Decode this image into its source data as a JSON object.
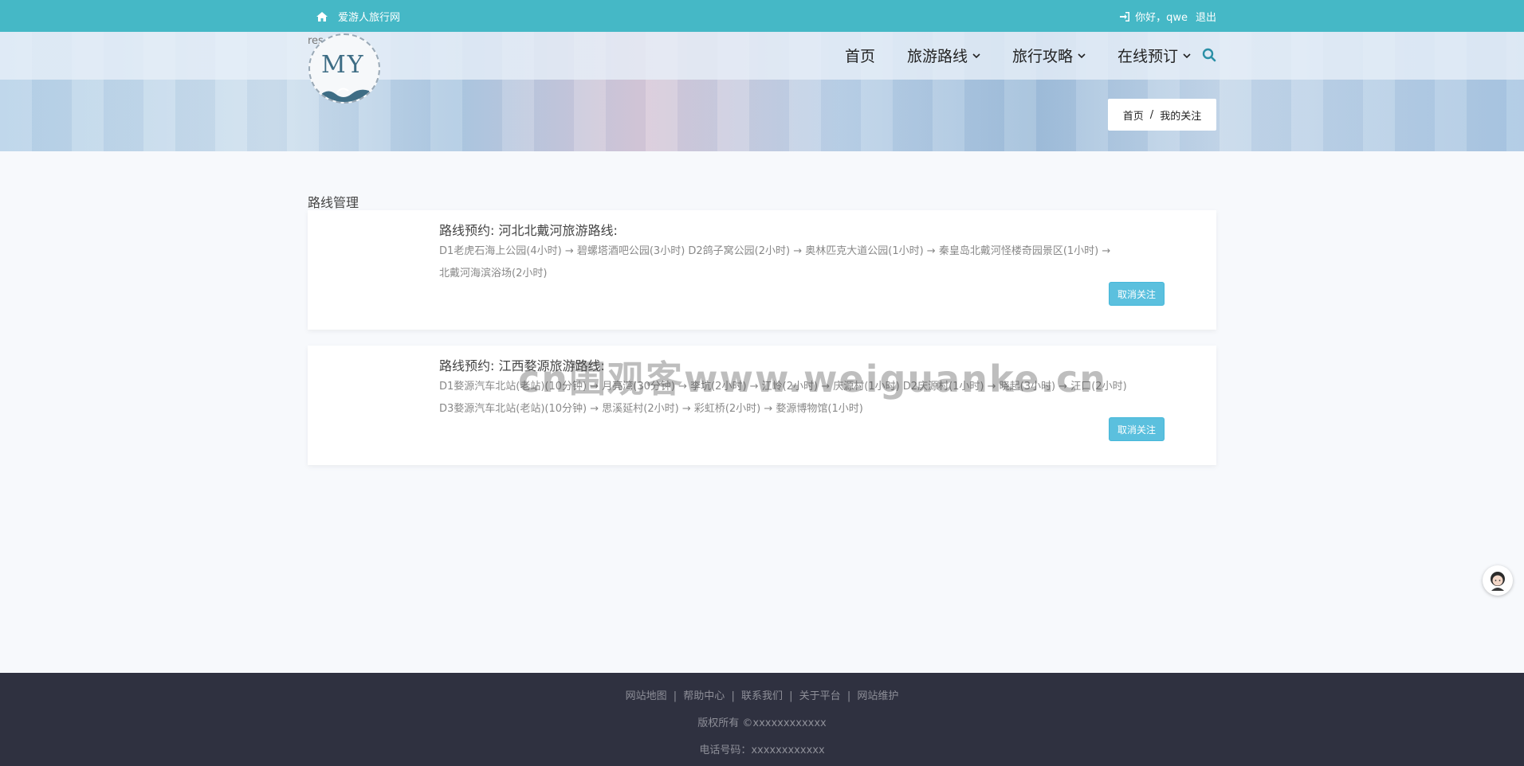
{
  "topbar": {
    "site_name": "爱游人旅行网",
    "greeting": "你好，qwe",
    "logout": "退出",
    "home_icon": "home-icon",
    "login_icon": "sign-in-icon",
    "bg_color": "#45b8c6"
  },
  "header": {
    "res_text": "res",
    "logo_text": "MY",
    "nav": [
      {
        "label": "首页",
        "has_dropdown": false
      },
      {
        "label": "旅游路线",
        "has_dropdown": true
      },
      {
        "label": "旅行攻略",
        "has_dropdown": true
      },
      {
        "label": "在线预订",
        "has_dropdown": true
      }
    ],
    "search_icon": "search-icon"
  },
  "breadcrumb": {
    "home": "首页",
    "sep": "/",
    "current": "我的关注"
  },
  "main": {
    "section_title": "路线管理",
    "cards": [
      {
        "title": "路线预约: 河北北戴河旅游路线:",
        "desc_line1": "D1老虎石海上公园(4小时) → 碧螺塔酒吧公园(3小时) D2鸽子窝公园(2小时) → 奥林匹克大道公园(1小时) → 秦皇岛北戴河怪楼奇园景区(1小时) →",
        "desc_line2": "北戴河海滨浴场(2小时)",
        "button": "取消关注"
      },
      {
        "title": "路线预约: 江西婺源旅游路线:",
        "desc_line1": "D1婺源汽车北站(老站)(10分钟) → 月亮湾(30分钟) → 李坑(2小时) → 江岭(2小时) → 庆源村(1小时) D2庆源村(1小时) → 晓起(3小时) → 汪口(2小时)",
        "desc_line2": "D3婺源汽车北站(老站)(10分钟) → 思溪延村(2小时) → 彩虹桥(2小时) → 婺源博物馆(1小时)",
        "button": "取消关注"
      }
    ]
  },
  "watermark": "cn围观客www.weiguanke.cn",
  "footer": {
    "links": [
      "网站地图",
      "帮助中心",
      "联系我们",
      "关于平台",
      "网站维护"
    ],
    "sep": "|",
    "copyright": "版权所有 ©xxxxxxxxxxxx",
    "phone": "电话号码：xxxxxxxxxxxx"
  },
  "colors": {
    "accent": "#45b8c6",
    "button": "#5bc0de",
    "footer_bg": "#2f3140"
  }
}
